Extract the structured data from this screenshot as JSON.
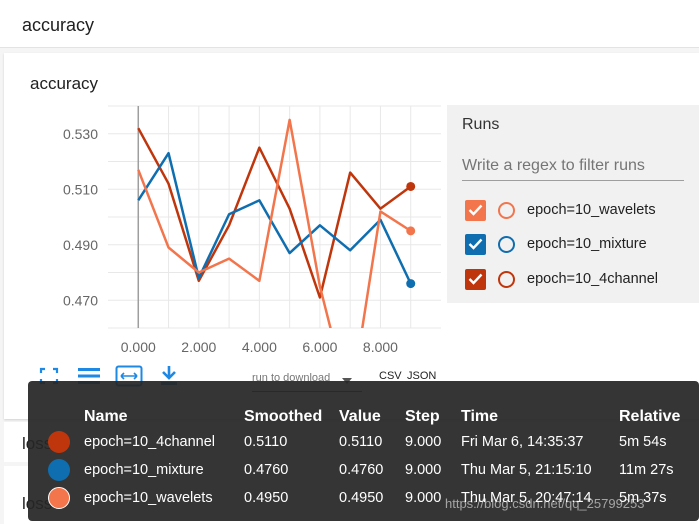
{
  "section": {
    "title": "accuracy"
  },
  "chart_data": {
    "type": "line",
    "title": "accuracy",
    "x_ticks": [
      "0.000",
      "2.000",
      "4.000",
      "6.000",
      "8.000"
    ],
    "y_ticks": [
      "0.530",
      "0.510",
      "0.490",
      "0.470"
    ],
    "xlim": [
      -1,
      10
    ],
    "ylim": [
      0.46,
      0.54
    ],
    "x": [
      0,
      1,
      2,
      3,
      4,
      5,
      6,
      7,
      8,
      9
    ],
    "grid": true,
    "series": [
      {
        "name": "epoch=10_4channel",
        "color": "#c0360c",
        "values": [
          0.532,
          0.512,
          0.477,
          0.497,
          0.525,
          0.503,
          0.471,
          0.516,
          0.503,
          0.511
        ]
      },
      {
        "name": "epoch=10_mixture",
        "color": "#0f6eaf",
        "values": [
          0.506,
          0.523,
          0.478,
          0.501,
          0.506,
          0.487,
          0.497,
          0.488,
          0.499,
          0.476
        ]
      },
      {
        "name": "epoch=10_wavelets",
        "color": "#f2754c",
        "values": [
          0.517,
          0.489,
          0.48,
          0.485,
          0.477,
          0.535,
          0.475,
          0.432,
          0.502,
          0.495
        ]
      }
    ]
  },
  "runs": {
    "title": "Runs",
    "filter_placeholder": "Write a regex to filter runs",
    "items": [
      {
        "label": "epoch=10_wavelets",
        "color": "#f2754c",
        "checked": true
      },
      {
        "label": "epoch=10_mixture",
        "color": "#0f6eaf",
        "checked": true
      },
      {
        "label": "epoch=10_4channel",
        "color": "#c0360c",
        "checked": true
      }
    ]
  },
  "toolbar": {
    "fit_icon": "fullscreen-icon",
    "log_icon": "list-icon",
    "domain_icon": "fit-domain-icon",
    "download_icon": "download-icon"
  },
  "download": {
    "run_label": "run to download",
    "csv": "CSV",
    "json": "JSON"
  },
  "lower_sections": [
    "loss",
    "loss"
  ],
  "tooltip": {
    "headers": {
      "name": "Name",
      "smoothed": "Smoothed",
      "value": "Value",
      "step": "Step",
      "time": "Time",
      "relative": "Relative"
    },
    "rows": [
      {
        "name": "epoch=10_4channel",
        "color": "#c0360c",
        "smoothed": "0.5110",
        "value": "0.5110",
        "step": "9.000",
        "time": "Fri Mar 6, 14:35:37",
        "relative": "5m 54s"
      },
      {
        "name": "epoch=10_mixture",
        "color": "#0f6eaf",
        "smoothed": "0.4760",
        "value": "0.4760",
        "step": "9.000",
        "time": "Thu Mar 5, 21:15:10",
        "relative": "11m 27s"
      },
      {
        "name": "epoch=10_wavelets",
        "color": "#f2754c",
        "smoothed": "0.4950",
        "value": "0.4950",
        "step": "9.000",
        "time": "Thu Mar 5, 20:47:14",
        "relative": "5m 37s"
      }
    ]
  },
  "watermark": "https://blog.csdn.net/qq_25799253"
}
